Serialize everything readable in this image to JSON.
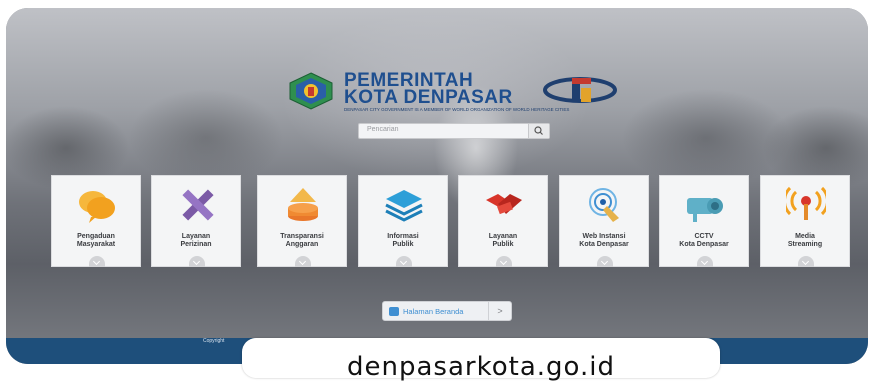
{
  "header": {
    "title_line1": "PEMERINTAH",
    "title_line2": "KOTA DENPASAR",
    "subtitle": "DENPASAR CITY GOVERNMENT IS A MEMBER OF WORLD ORGANIZATION OF WORLD HERITAGE CITIES"
  },
  "search": {
    "placeholder": "Pencarian"
  },
  "tiles": [
    {
      "label_line1": "Pengaduan",
      "label_line2": "Masyarakat",
      "icon": "speech-bubbles-icon"
    },
    {
      "label_line1": "Layanan",
      "label_line2": "Perizinan",
      "icon": "ruler-pencil-icon"
    },
    {
      "label_line1": "Transparansi",
      "label_line2": "Anggaran",
      "icon": "coins-stack-icon"
    },
    {
      "label_line1": "Informasi",
      "label_line2": "Publik",
      "icon": "layers-icon"
    },
    {
      "label_line1": "Layanan",
      "label_line2": "Publik",
      "icon": "handshake-icon"
    },
    {
      "label_line1": "Web Instansi",
      "label_line2": "Kota Denpasar",
      "icon": "touch-target-icon"
    },
    {
      "label_line1": "CCTV",
      "label_line2": "Kota Denpasar",
      "icon": "cctv-camera-icon"
    },
    {
      "label_line1": "Media",
      "label_line2": "Streaming",
      "icon": "broadcast-icon"
    }
  ],
  "home_button": {
    "label": "Halaman Beranda",
    "arrow": ">"
  },
  "footer": {
    "copyright": "Copyright"
  },
  "url_caption": "denpasarkota.go.id",
  "colors": {
    "brand_blue": "#1f4f8f",
    "footer_blue": "#1e4f7b",
    "link_blue": "#3f8fd2"
  }
}
